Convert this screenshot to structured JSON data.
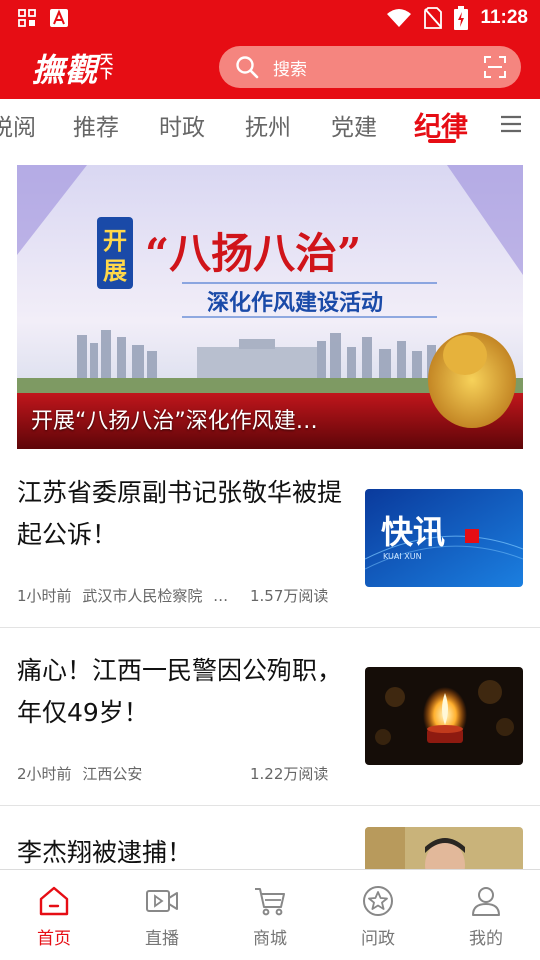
{
  "status_bar": {
    "time": "11:28"
  },
  "header": {
    "logo_main": "撫觀",
    "logo_side": [
      "天",
      "下"
    ],
    "search_placeholder": "搜索"
  },
  "tabs": [
    {
      "label": "悦阅",
      "active": false
    },
    {
      "label": "推荐",
      "active": false
    },
    {
      "label": "时政",
      "active": false
    },
    {
      "label": "抚州",
      "active": false
    },
    {
      "label": "党建",
      "active": false
    },
    {
      "label": "纪律",
      "active": true
    }
  ],
  "banner": {
    "title": "开展“八扬八治”深化作风建…",
    "poster_badge": [
      "开",
      "展"
    ],
    "poster_headline": "“八扬八治”",
    "poster_subhead": "深化作风建设活动"
  },
  "articles": [
    {
      "title": "江苏省委原副书记张敬华被提起公诉！",
      "time": "1小时前",
      "source": "武汉市人民检察院",
      "more": "…",
      "reads": "1.57万阅读",
      "thumb_text": "快讯",
      "thumb_sub": "KUAI XUN"
    },
    {
      "title": "痛心！江西一民警因公殉职，年仅49岁！",
      "time": "2小时前",
      "source": "江西公安",
      "reads": "1.22万阅读"
    },
    {
      "title": "李杰翔被逮捕！"
    }
  ],
  "bottom_nav": [
    {
      "label": "首页",
      "icon": "home-icon",
      "active": true
    },
    {
      "label": "直播",
      "icon": "video-icon",
      "active": false
    },
    {
      "label": "商城",
      "icon": "cart-icon",
      "active": false
    },
    {
      "label": "问政",
      "icon": "star-badge-icon",
      "active": false
    },
    {
      "label": "我的",
      "icon": "user-icon",
      "active": false
    }
  ],
  "colors": {
    "brand_red": "#e60d14",
    "search_bg": "#f5857f",
    "text_gray": "#666666"
  }
}
